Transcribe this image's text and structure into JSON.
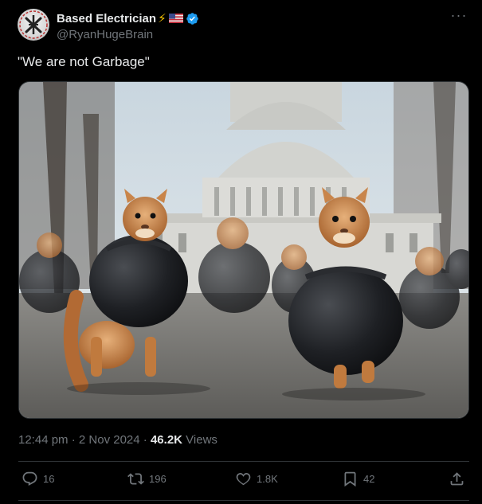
{
  "author": {
    "display_name": "Based Electrician",
    "handle": "@RyanHugeBrain",
    "badges": [
      "lightning-emoji",
      "us-flag-emoji",
      "verified-icon"
    ],
    "verified_color": "#1d9bf0"
  },
  "tweet": {
    "text": "\"We are not Garbage\"",
    "media": {
      "type": "image"
    }
  },
  "meta": {
    "time": "12:44 pm",
    "separator": "·",
    "date": "2 Nov 2024",
    "separator2": "·",
    "views_count": "46.2K",
    "views_label": "Views"
  },
  "actions": {
    "reply_count": "16",
    "retweet_count": "196",
    "like_count": "1.8K",
    "bookmark_count": "42"
  },
  "menu": {
    "more_label": "···"
  }
}
